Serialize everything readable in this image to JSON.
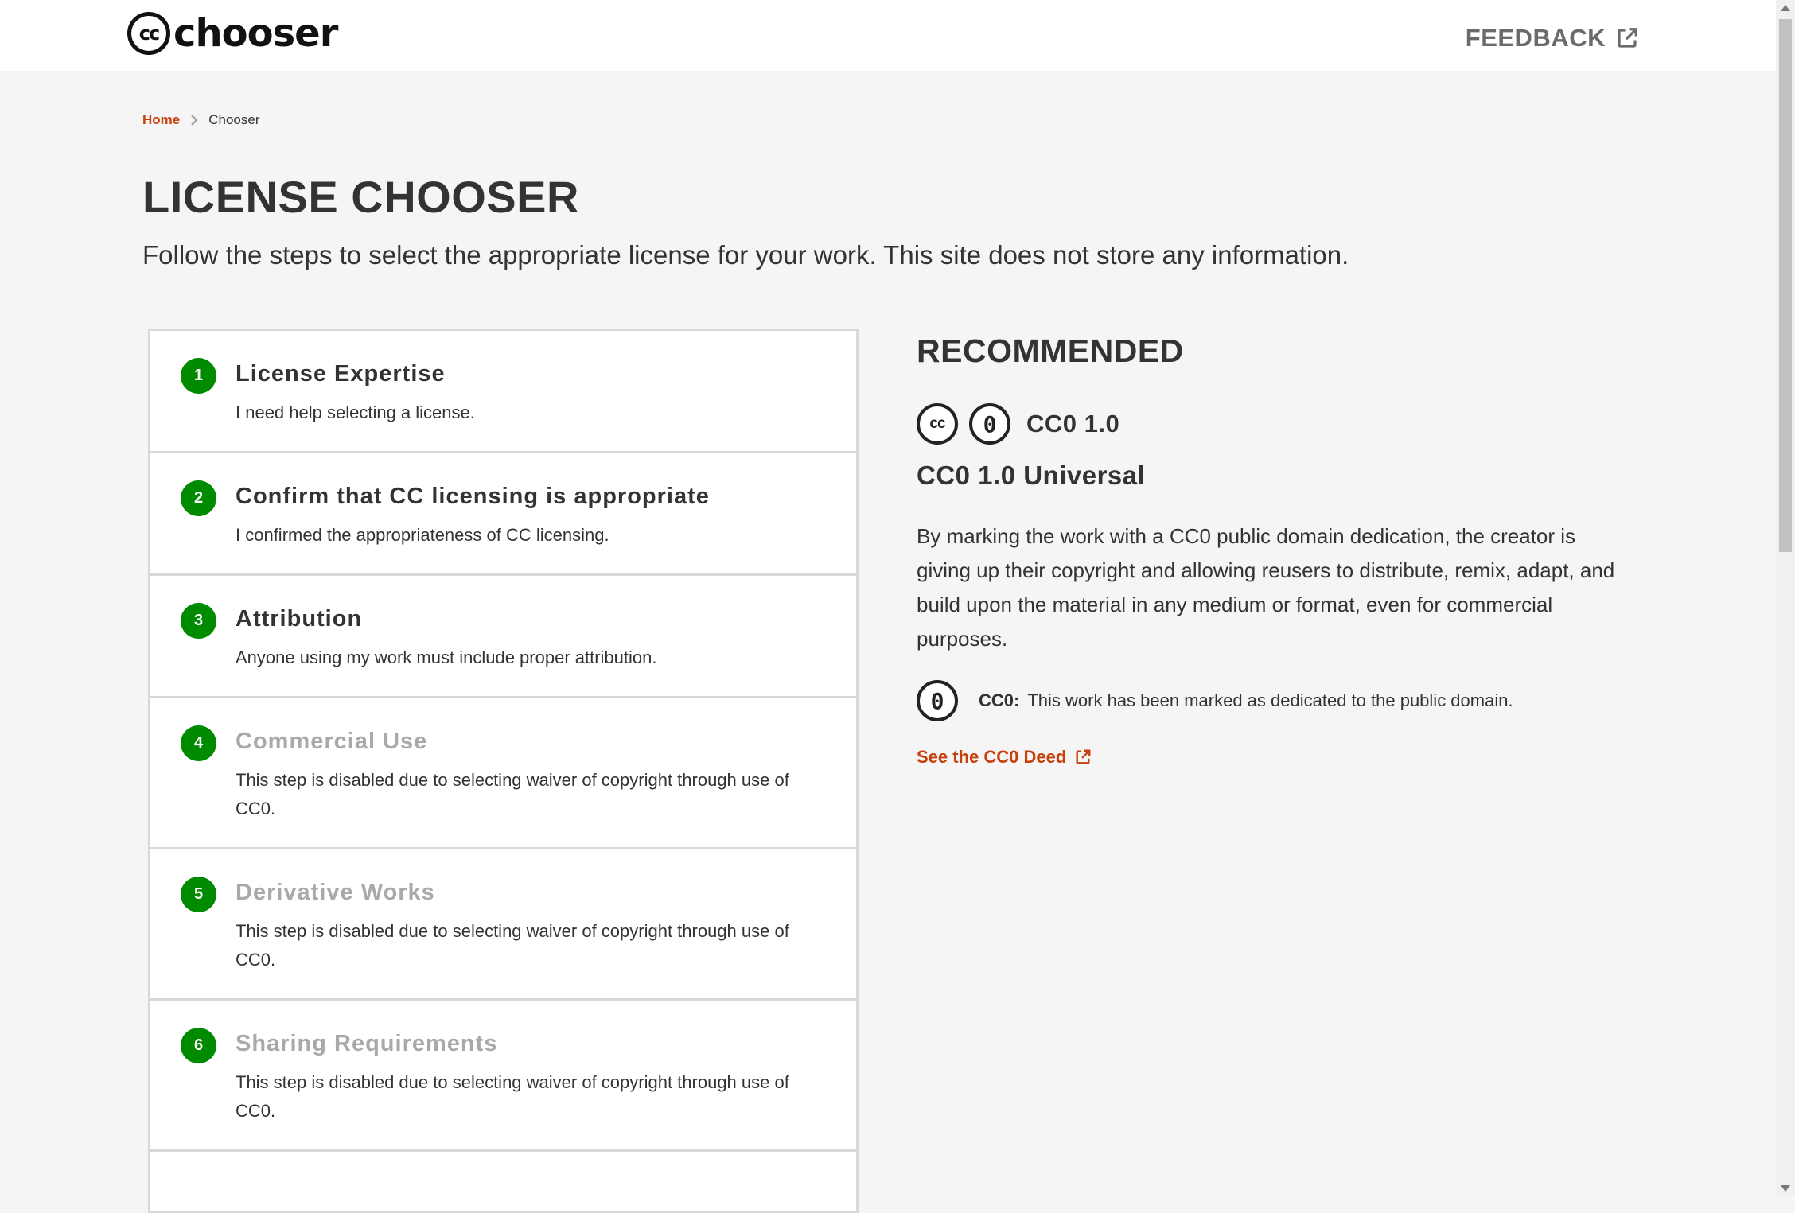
{
  "header": {
    "logo_mark": "cc",
    "logo_word": "chooser",
    "feedback_label": "FEEDBACK"
  },
  "breadcrumb": {
    "home": "Home",
    "current": "Chooser"
  },
  "page": {
    "title": "LICENSE CHOOSER",
    "subtitle": "Follow the steps to select the appropriate license for your work. This site does not store any information."
  },
  "steps": [
    {
      "number": "1",
      "title": "License Expertise",
      "desc": "I need help selecting a license.",
      "state": "done"
    },
    {
      "number": "2",
      "title": "Confirm that CC licensing is appropriate",
      "desc": "I confirmed the appropriateness of CC licensing.",
      "state": "done"
    },
    {
      "number": "3",
      "title": "Attribution",
      "desc": "Anyone using my work must include proper attribution.",
      "state": "done"
    },
    {
      "number": "4",
      "title": "Commercial Use",
      "desc": "This step is disabled due to selecting waiver of copyright through use of CC0.",
      "state": "disabled"
    },
    {
      "number": "5",
      "title": "Derivative Works",
      "desc": "This step is disabled due to selecting waiver of copyright through use of CC0.",
      "state": "disabled"
    },
    {
      "number": "6",
      "title": "Sharing Requirements",
      "desc": "This step is disabled due to selecting waiver of copyright through use of CC0.",
      "state": "disabled"
    }
  ],
  "recommended": {
    "heading": "RECOMMENDED",
    "icon_cc": "cc",
    "icon_zero": "0",
    "short_name": "CC0 1.0",
    "full_name": "CC0 1.0 Universal",
    "description": "By marking the work with a CC0 public domain dedication, the creator is giving up their copyright and allowing reusers to distribute, remix, adapt, and build upon the material in any medium or format, even for commercial purposes.",
    "mark_label": "CC0:",
    "mark_text": "This work has been marked as dedicated to the public domain.",
    "deed_link": "See the CC0 Deed"
  },
  "colors": {
    "accent": "#c7400c",
    "step_badge": "#008a00",
    "disabled_text": "#a9a9a9"
  }
}
